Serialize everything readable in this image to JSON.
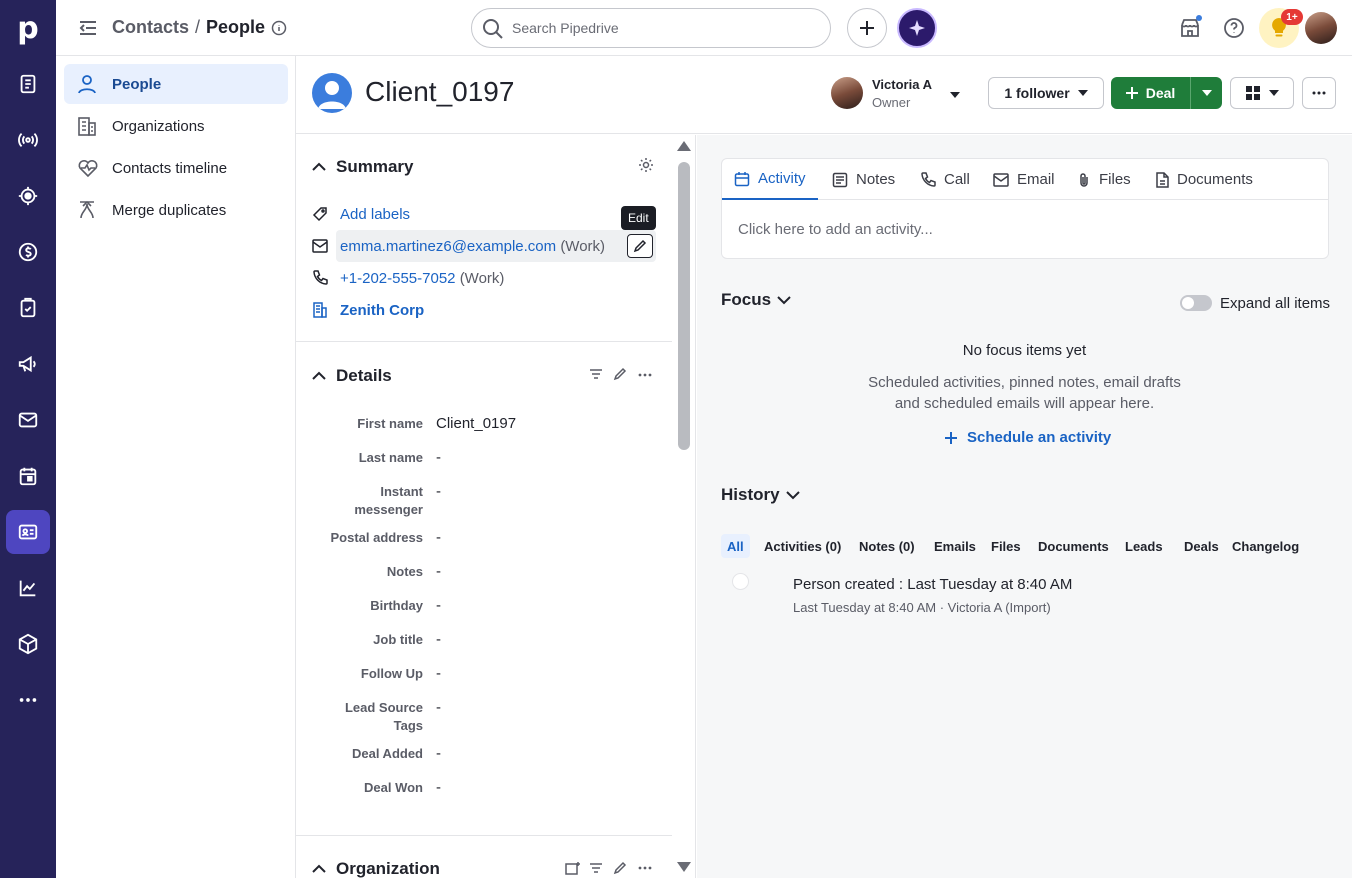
{
  "rail": {
    "logo": "p",
    "items": [
      "deals-icon",
      "leads-icon",
      "focus-icon",
      "sales-icon",
      "tasks-icon",
      "campaigns-icon",
      "mail-icon",
      "calendar-icon",
      "contacts-icon",
      "insights-icon",
      "products-icon",
      "more-icon"
    ],
    "active": "contacts-icon"
  },
  "topbar": {
    "breadcrumb_parent": "Contacts",
    "breadcrumb_sep": "/",
    "breadcrumb_current": "People",
    "search_placeholder": "Search Pipedrive",
    "notification_badge": "1+"
  },
  "subnav": {
    "items": [
      {
        "label": "People",
        "icon": "person-icon"
      },
      {
        "label": "Organizations",
        "icon": "building-icon"
      },
      {
        "label": "Contacts timeline",
        "icon": "heartbeat-icon"
      },
      {
        "label": "Merge duplicates",
        "icon": "merge-icon"
      }
    ]
  },
  "header": {
    "title": "Client_0197",
    "owner_name": "Victoria A",
    "owner_role": "Owner",
    "follower_label": "1 follower",
    "deal_label": "Deal"
  },
  "summary": {
    "heading": "Summary",
    "add_labels": "Add labels",
    "email": "emma.martinez6@example.com",
    "email_type": "(Work)",
    "phone": "+1-202-555-7052",
    "phone_type": "(Work)",
    "organization": "Zenith Corp",
    "tooltip": "Edit"
  },
  "details": {
    "heading": "Details",
    "fields": [
      {
        "label": "First name",
        "value": "Client_0197"
      },
      {
        "label": "Last name",
        "value": "-"
      },
      {
        "label": "Instant messenger",
        "value": "-"
      },
      {
        "label": "Postal address",
        "value": "-"
      },
      {
        "label": "Notes",
        "value": "-"
      },
      {
        "label": "Birthday",
        "value": "-"
      },
      {
        "label": "Job title",
        "value": "-"
      },
      {
        "label": "Follow Up",
        "value": "-"
      },
      {
        "label": "Lead Source Tags",
        "value": "-"
      },
      {
        "label": "Deal Added",
        "value": "-"
      },
      {
        "label": "Deal Won",
        "value": "-"
      }
    ]
  },
  "organization_section": {
    "heading": "Organization"
  },
  "composer": {
    "tabs": [
      "Activity",
      "Notes",
      "Call",
      "Email",
      "Files",
      "Documents"
    ],
    "placeholder": "Click here to add an activity..."
  },
  "focus": {
    "heading": "Focus",
    "toggle_label": "Expand all items",
    "empty_title": "No focus items yet",
    "empty_desc_1": "Scheduled activities, pinned notes, email drafts",
    "empty_desc_2": "and scheduled emails will appear here.",
    "schedule_link": "Schedule an activity"
  },
  "history": {
    "heading": "History",
    "filters": [
      "All",
      "Activities (0)",
      "Notes (0)",
      "Emails",
      "Files",
      "Documents",
      "Leads",
      "Deals",
      "Changelog"
    ],
    "entry_title": "Person created : Last Tuesday at 8:40 AM",
    "entry_meta": "Last Tuesday at 8:40 AM · Victoria A (Import)"
  }
}
